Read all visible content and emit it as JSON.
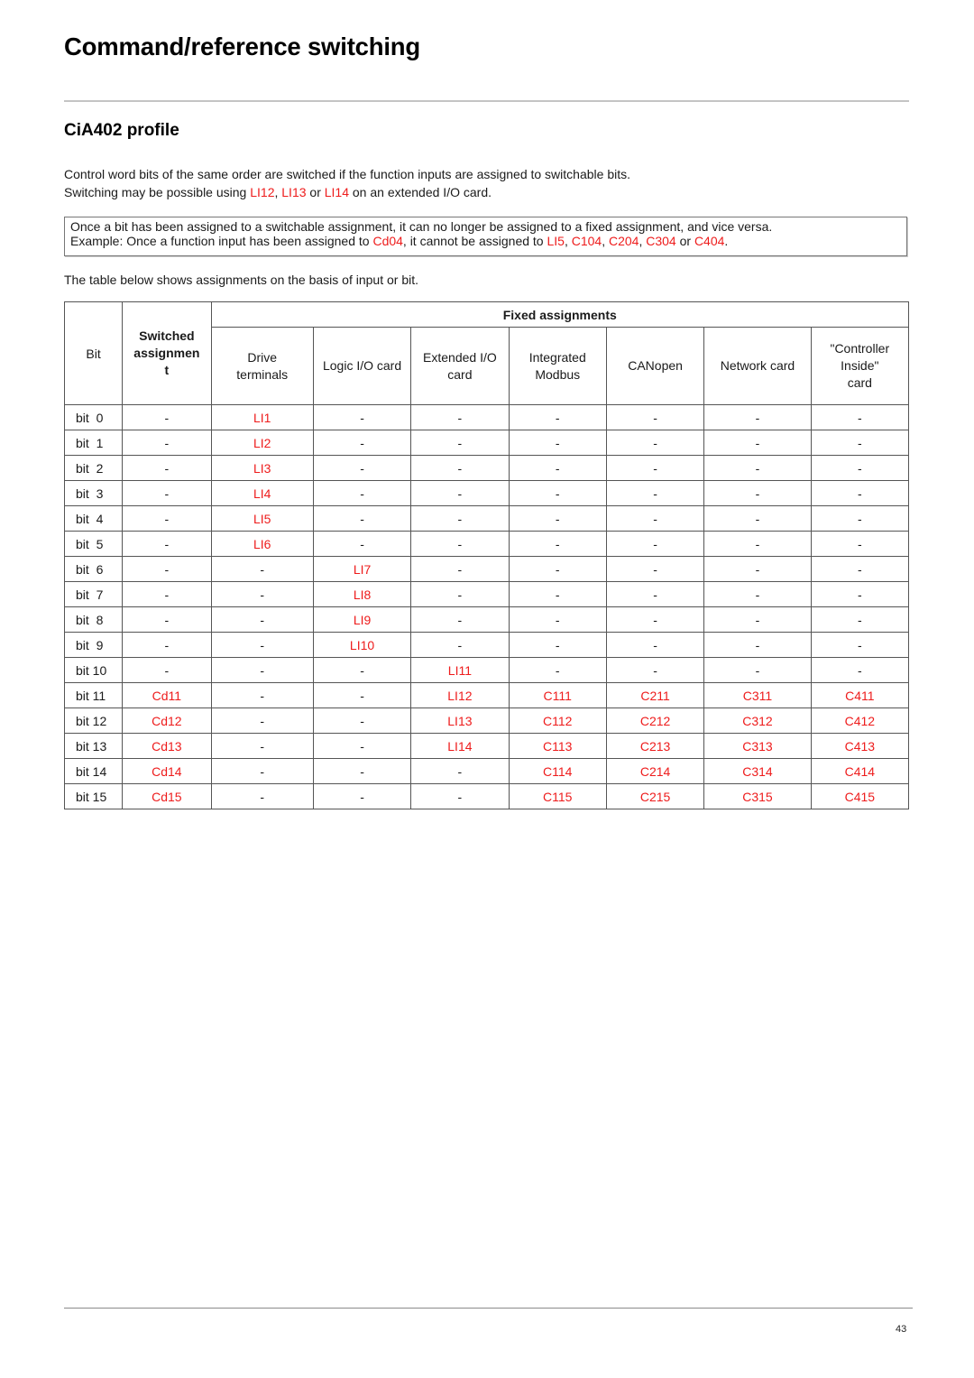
{
  "page": {
    "title": "Command/reference switching",
    "subtitle": "CiA402 profile",
    "page_number": "43"
  },
  "intro": {
    "line1": "Control word bits of the same order are switched if the function inputs are assigned to switchable bits.",
    "line2_prefix": "Switching may be possible using ",
    "line2_ref1": "LI12",
    "line2_sep1": ", ",
    "line2_ref2": "LI13",
    "line2_sep2": " or ",
    "line2_ref3": "LI14",
    "line2_suffix": " on an extended I/O card."
  },
  "note": {
    "line1": "Once a bit has been assigned to a switchable assignment, it can no longer be assigned to a fixed assignment, and vice versa.",
    "line2_prefix": "Example: Once a function input has been assigned to ",
    "ref_cd": "Cd04",
    "line2_mid": ", it cannot be assigned to ",
    "ref_li": "LI5",
    "sep1": ", ",
    "ref_c1": "C104",
    "sep2": ", ",
    "ref_c2": "C204",
    "sep3": ", ",
    "ref_c3": "C304",
    "sep4": " or ",
    "ref_c4": "C404",
    "end": "."
  },
  "table_intro": "The table below shows assignments on the basis of input or bit.",
  "table": {
    "col_bit": "Bit",
    "col_switched_1": "Switched",
    "col_switched_2": "assignmen",
    "col_switched_3": "t",
    "group_fixed": "Fixed assignments",
    "fixed_cols": [
      {
        "l1": "Drive",
        "l2": "terminals",
        "l3": ""
      },
      {
        "l1": "Logic I/O card",
        "l2": "",
        "l3": ""
      },
      {
        "l1": "Extended I/O",
        "l2": "card",
        "l3": ""
      },
      {
        "l1": "Integrated",
        "l2": "Modbus",
        "l3": ""
      },
      {
        "l1": "CANopen",
        "l2": "",
        "l3": ""
      },
      {
        "l1": "Network card",
        "l2": "",
        "l3": ""
      },
      {
        "l1": "\"Controller",
        "l2": "Inside\"",
        "l3": "card"
      }
    ],
    "rows": [
      {
        "bit": "bit  0",
        "cells": [
          "-",
          "LI1",
          "-",
          "-",
          "-",
          "-",
          "-",
          "-"
        ]
      },
      {
        "bit": "bit  1",
        "cells": [
          "-",
          "LI2",
          "-",
          "-",
          "-",
          "-",
          "-",
          "-"
        ]
      },
      {
        "bit": "bit  2",
        "cells": [
          "-",
          "LI3",
          "-",
          "-",
          "-",
          "-",
          "-",
          "-"
        ]
      },
      {
        "bit": "bit  3",
        "cells": [
          "-",
          "LI4",
          "-",
          "-",
          "-",
          "-",
          "-",
          "-"
        ]
      },
      {
        "bit": "bit  4",
        "cells": [
          "-",
          "LI5",
          "-",
          "-",
          "-",
          "-",
          "-",
          "-"
        ]
      },
      {
        "bit": "bit  5",
        "cells": [
          "-",
          "LI6",
          "-",
          "-",
          "-",
          "-",
          "-",
          "-"
        ]
      },
      {
        "bit": "bit  6",
        "cells": [
          "-",
          "-",
          "LI7",
          "-",
          "-",
          "-",
          "-",
          "-"
        ]
      },
      {
        "bit": "bit  7",
        "cells": [
          "-",
          "-",
          "LI8",
          "-",
          "-",
          "-",
          "-",
          "-"
        ]
      },
      {
        "bit": "bit  8",
        "cells": [
          "-",
          "-",
          "LI9",
          "-",
          "-",
          "-",
          "-",
          "-"
        ]
      },
      {
        "bit": "bit  9",
        "cells": [
          "-",
          "-",
          "LI10",
          "-",
          "-",
          "-",
          "-",
          "-"
        ]
      },
      {
        "bit": "bit 10",
        "cells": [
          "-",
          "-",
          "-",
          "LI11",
          "-",
          "-",
          "-",
          "-"
        ]
      },
      {
        "bit": "bit 11",
        "cells": [
          "Cd11",
          "-",
          "-",
          "LI12",
          "C111",
          "C211",
          "C311",
          "C411"
        ]
      },
      {
        "bit": "bit 12",
        "cells": [
          "Cd12",
          "-",
          "-",
          "LI13",
          "C112",
          "C212",
          "C312",
          "C412"
        ]
      },
      {
        "bit": "bit 13",
        "cells": [
          "Cd13",
          "-",
          "-",
          "LI14",
          "C113",
          "C213",
          "C313",
          "C413"
        ]
      },
      {
        "bit": "bit 14",
        "cells": [
          "Cd14",
          "-",
          "-",
          "-",
          "C114",
          "C214",
          "C314",
          "C414"
        ]
      },
      {
        "bit": "bit 15",
        "cells": [
          "Cd15",
          "-",
          "-",
          "-",
          "C115",
          "C215",
          "C315",
          "C415"
        ]
      }
    ]
  },
  "colors": {
    "reference_red": "#ee1c1c",
    "text": "#1a1a1a"
  }
}
